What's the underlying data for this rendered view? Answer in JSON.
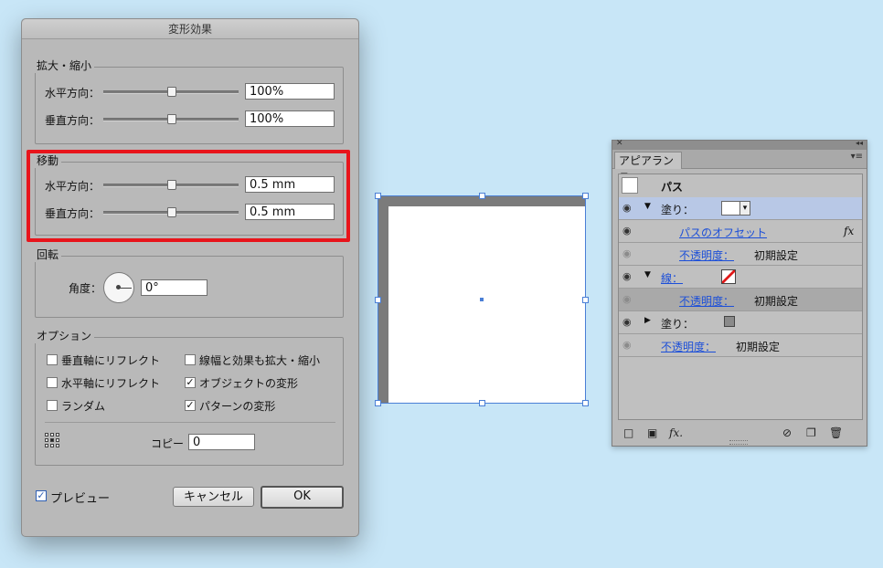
{
  "dialog": {
    "title": "変形効果",
    "scale": {
      "legend": "拡大・縮小",
      "horizontal_label": "水平方向：",
      "horizontal_value": "100%",
      "vertical_label": "垂直方向：",
      "vertical_value": "100%"
    },
    "move": {
      "legend": "移動",
      "horizontal_label": "水平方向：",
      "horizontal_value": "0.5 mm",
      "vertical_label": "垂直方向：",
      "vertical_value": "0.5 mm"
    },
    "rotate": {
      "legend": "回転",
      "angle_label": "角度：",
      "angle_value": "0°"
    },
    "options": {
      "legend": "オプション",
      "reflect_vertical": "垂直軸にリフレクト",
      "reflect_horizontal": "水平軸にリフレクト",
      "random": "ランダム",
      "scale_strokes": "線幅と効果も拡大・縮小",
      "transform_objects": "オブジェクトの変形",
      "transform_patterns": "パターンの変形",
      "copies_label": "コピー",
      "copies_value": "0",
      "check_mark": "✓"
    },
    "preview_label": "プレビュー",
    "cancel_label": "キャンセル",
    "ok_label": "OK"
  },
  "panel": {
    "close_glyph": "✕",
    "collapse_glyph": "◂◂",
    "tab_label": "アピアランス",
    "menu_glyph": "▾≡",
    "eye_glyph": "◉",
    "expand_glyph": "▼",
    "collapse_row_glyph": "▶",
    "dropdown_glyph": "▾",
    "object_name": "パス",
    "fill_label": "塗り：",
    "offset_path_label": "パスのオフセット",
    "fx_label": "fx",
    "opacity_label": "不透明度：",
    "opacity_value": "初期設定",
    "stroke_label": "線：",
    "footer": {
      "new_fill_glyph": "□",
      "new_stroke_glyph": "▣",
      "fx_glyph": "fx.",
      "clear_glyph": "⊘",
      "duplicate_glyph": "❐",
      "delete_glyph": "🗑"
    }
  },
  "colors": {
    "highlight": "#e8141b",
    "link": "#1c4fd8",
    "selection": "#4a7fd6"
  }
}
